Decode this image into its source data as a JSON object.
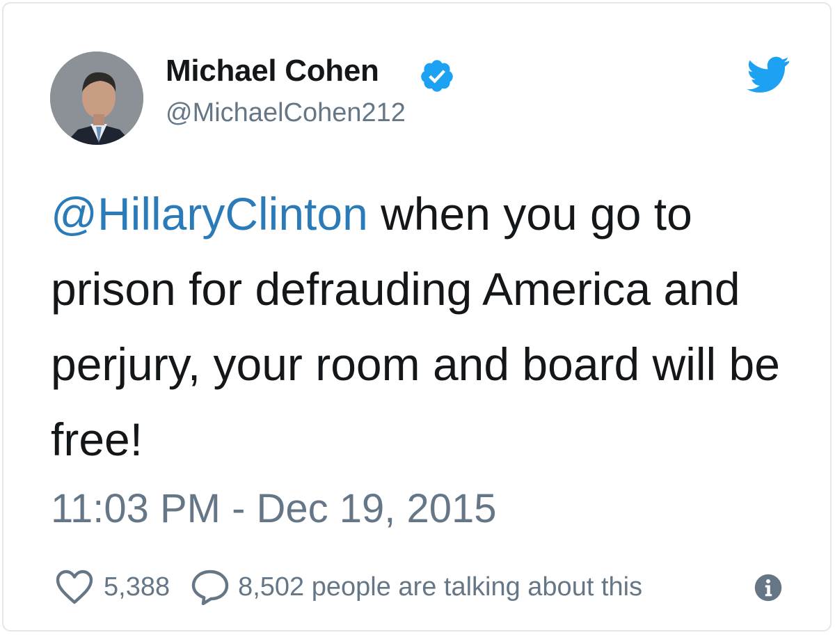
{
  "author": {
    "display_name": "Michael Cohen",
    "handle": "@MichaelCohen212",
    "verified": true,
    "avatar_icon": "profile-photo"
  },
  "tweet": {
    "mention": "@HillaryClinton",
    "text": " when you go to prison for defrauding America and perjury, your room and board will be free!",
    "timestamp": "11:03 PM - Dec 19, 2015"
  },
  "engagement": {
    "likes": "5,388",
    "talking": "8,502 people are talking about this"
  },
  "icons": {
    "brand": "twitter-bird-icon",
    "verified": "verified-badge-icon",
    "like": "heart-icon",
    "reply": "comment-icon",
    "info": "info-icon"
  },
  "colors": {
    "brand_blue": "#1da1f2",
    "mention_blue": "#2b7bb9",
    "text": "#14171a",
    "secondary": "#657786",
    "border": "#e1e8ed"
  }
}
